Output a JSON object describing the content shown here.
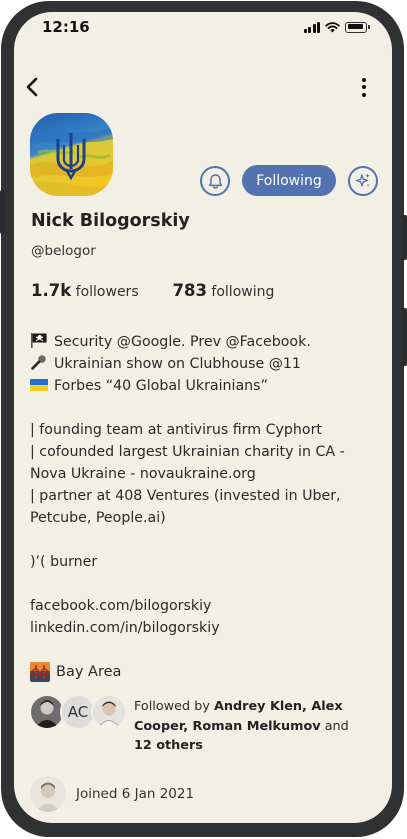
{
  "status_bar": {
    "time": "12:16"
  },
  "profile": {
    "name": "Nick Bilogorskiy",
    "handle": "@belogor",
    "follow_button_label": "Following"
  },
  "stats": {
    "followers_count": "1.7k",
    "followers_label": "followers",
    "following_count": "783",
    "following_label": "following"
  },
  "bio": {
    "line1": "Security @Google. Prev @Facebook.",
    "line2": "Ukrainian show on Clubhouse @11",
    "line3": "Forbes “40 Global Ukrainians”",
    "line4": "| founding team at antivirus firm Cyphort",
    "line5": "| cofounded largest Ukrainian charity in CA - Nova Ukraine - novaukraine.org",
    "line6": "| partner at 408 Ventures (invested in Uber, Petcube, People.ai)",
    "line7": ")’( burner",
    "link1": "facebook.com/bilogorskiy",
    "link2": "linkedin.com/in/bilogorskiy"
  },
  "location": "Bay Area",
  "followed_by": {
    "prefix": "Followed by",
    "names": "Andrey Klen, Alex Cooper, Roman Melkumov",
    "conjunction": "and",
    "others": "12 others",
    "initials_avatar": "AC"
  },
  "joined": "Joined 6 Jan 2021",
  "colors": {
    "background": "#f2efe4",
    "accent": "#5273b0",
    "text": "#222222"
  },
  "icons": [
    "back-arrow-icon",
    "more-vertical-icon",
    "bell-icon",
    "sparkle-icon",
    "pirate-flag-icon",
    "microphone-icon",
    "ukraine-flag-icon",
    "bridge-icon"
  ]
}
